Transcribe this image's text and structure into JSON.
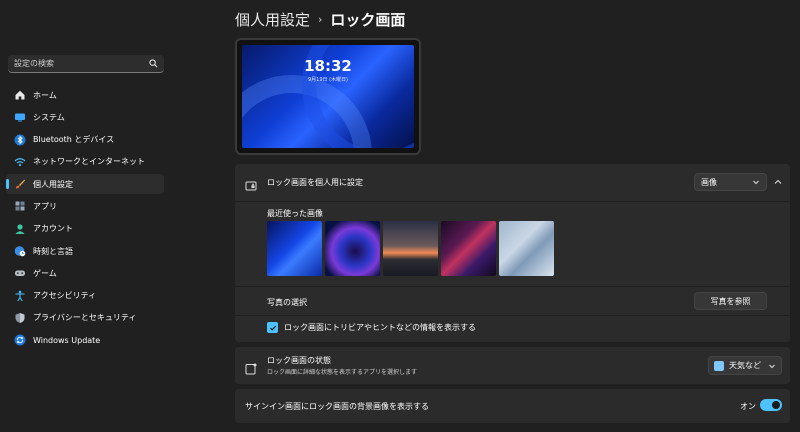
{
  "sidebar": {
    "search_placeholder": "設定の検索",
    "items": [
      {
        "label": "ホーム",
        "icon": "home-icon"
      },
      {
        "label": "システム",
        "icon": "system-icon"
      },
      {
        "label": "Bluetooth とデバイス",
        "icon": "bluetooth-icon"
      },
      {
        "label": "ネットワークとインターネット",
        "icon": "wifi-icon"
      },
      {
        "label": "個人用設定",
        "icon": "brush-icon",
        "active": true
      },
      {
        "label": "アプリ",
        "icon": "apps-icon"
      },
      {
        "label": "アカウント",
        "icon": "account-icon"
      },
      {
        "label": "時刻と言語",
        "icon": "globe-clock-icon"
      },
      {
        "label": "ゲーム",
        "icon": "gamepad-icon"
      },
      {
        "label": "アクセシビリティ",
        "icon": "accessibility-icon"
      },
      {
        "label": "プライバシーとセキュリティ",
        "icon": "shield-icon"
      },
      {
        "label": "Windows Update",
        "icon": "update-icon"
      }
    ]
  },
  "header": {
    "parent": "個人用設定",
    "separator": "›",
    "current": "ロック画面"
  },
  "preview": {
    "time": "18:32",
    "date": "9月19日 (木曜日)"
  },
  "personalize": {
    "title": "ロック画面を個人用に設定",
    "dropdown_value": "画像",
    "recent_images_title": "最近使った画像",
    "photo_select_label": "写真の選択",
    "browse_label": "写真を参照",
    "checkbox_label": "ロック画面にトリビアやヒントなどの情報を表示する",
    "checkbox_checked": true
  },
  "status": {
    "title": "ロック画面の状態",
    "subtitle": "ロック画面に詳細な状態を表示するアプリを選択します",
    "dropdown_value": "天気など"
  },
  "signin": {
    "title": "サインイン画面にロック画面の背景画像を表示する",
    "toggle_state": "オン",
    "toggle_on": true
  },
  "colors": {
    "accent": "#4cc2ff",
    "background": "#202020",
    "card": "#2b2b2b"
  }
}
